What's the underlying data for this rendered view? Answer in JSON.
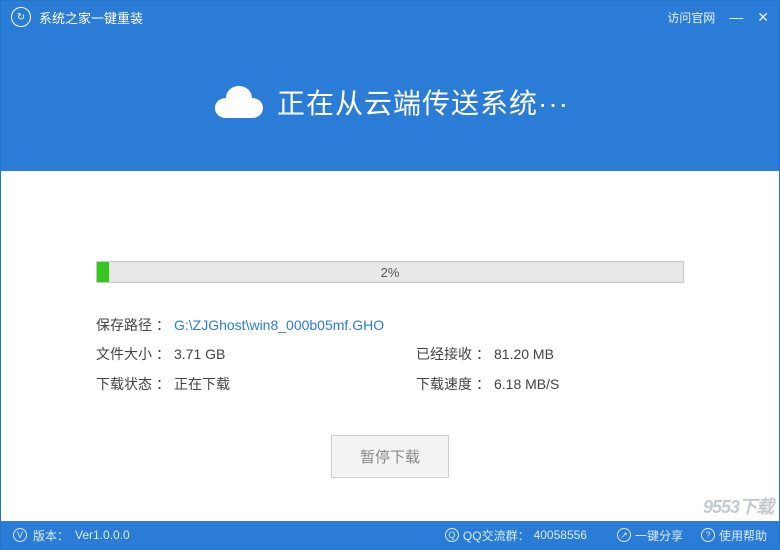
{
  "titlebar": {
    "app_title": "系统之家一键重装",
    "visit_link": "访问官网"
  },
  "banner": {
    "status_text": "正在从云端传送系统···"
  },
  "progress": {
    "percent": 2,
    "percent_label": "2%"
  },
  "info": {
    "save_path_label": "保存路径",
    "save_path_value": "G:\\ZJGhost\\win8_000b05mf.GHO",
    "file_size_label": "文件大小",
    "file_size_value": "3.71 GB",
    "received_label": "已经接收",
    "received_value": "81.20 MB",
    "status_label": "下载状态",
    "status_value": "正在下载",
    "speed_label": "下载速度",
    "speed_value": "6.18 MB/S",
    "sep": "："
  },
  "actions": {
    "pause_label": "暂停下载"
  },
  "footer": {
    "version_label": "版本：",
    "version_value": "Ver1.0.0.0",
    "qq_label": "QQ交流群：",
    "qq_value": "40058556",
    "share_label": "一键分享",
    "help_label": "使用帮助"
  },
  "watermark": "9553下载"
}
